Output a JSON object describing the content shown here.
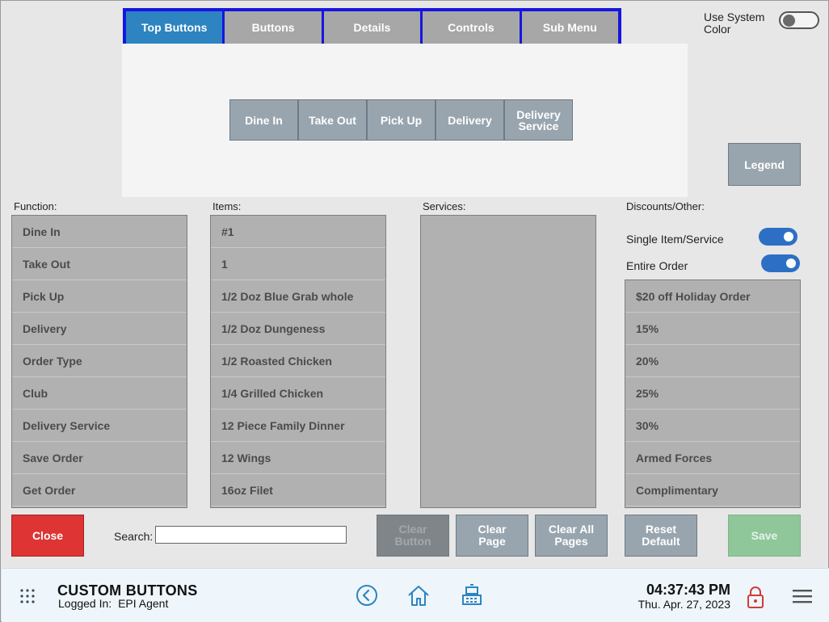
{
  "tabs": [
    {
      "label": "Top Buttons",
      "active": true
    },
    {
      "label": "Buttons"
    },
    {
      "label": "Details"
    },
    {
      "label": "Controls"
    },
    {
      "label": "Sub Menu"
    }
  ],
  "use_system_color": {
    "label": "Use System Color",
    "on": false
  },
  "preview_buttons": [
    "Dine In",
    "Take Out",
    "Pick Up",
    "Delivery",
    "Delivery Service"
  ],
  "legend_label": "Legend",
  "sections": {
    "function": "Function:",
    "items": "Items:",
    "services": "Services:",
    "discounts": "Discounts/Other:"
  },
  "function_list": [
    "Dine In",
    "Take Out",
    "Pick Up",
    "Delivery",
    "Order Type",
    "Club",
    "Delivery Service",
    "Save Order",
    "Get Order"
  ],
  "items_list": [
    "#1",
    "1",
    "1/2 Doz Blue Grab whole",
    "1/2 Doz Dungeness",
    "1/2 Roasted Chicken",
    "1/4 Grilled Chicken",
    "12 Piece Family Dinner",
    "12 Wings",
    "16oz Filet"
  ],
  "services_list": [],
  "discount_options": [
    {
      "label": "Single Item/Service",
      "on": true
    },
    {
      "label": "Entire Order",
      "on": true
    }
  ],
  "discounts_list": [
    "$20 off Holiday Order",
    "15%",
    "20%",
    "25%",
    "30%",
    "Armed Forces",
    "Complimentary"
  ],
  "actions": {
    "close": "Close",
    "search_label": "Search:",
    "search_value": "",
    "clear_button": "Clear Button",
    "clear_page": "Clear Page",
    "clear_all_pages": "Clear All Pages",
    "reset_default": "Reset Default",
    "save": "Save"
  },
  "footer": {
    "title": "CUSTOM BUTTONS",
    "logged_in_label": "Logged In:",
    "user": "EPI Agent",
    "time": "04:37:43 PM",
    "date": "Thu. Apr. 27, 2023",
    "icons": [
      "grid-icon",
      "back-icon",
      "home-icon",
      "register-icon",
      "lock-icon",
      "menu-icon"
    ]
  },
  "colors": {
    "active_tab": "#2d84c0",
    "tab_bar_border": "#1616e0",
    "close": "#de3434",
    "save": "#8fc79a",
    "button": "#98a5ae",
    "toggle_on": "#2d6fc4"
  }
}
